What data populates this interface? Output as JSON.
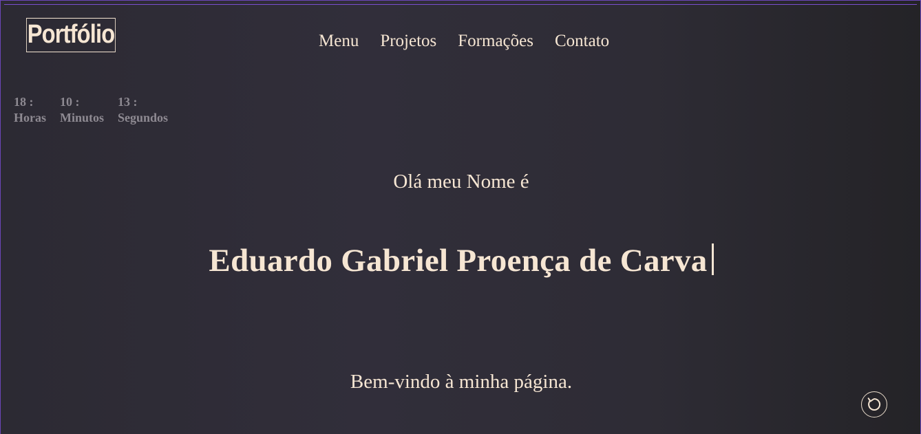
{
  "header": {
    "logo": "Portfólio",
    "nav": [
      "Menu",
      "Projetos",
      "Formações",
      "Contato"
    ]
  },
  "clock": {
    "hours_value": "18 :",
    "hours_label": "Horas",
    "minutes_value": "10 :",
    "minutes_label": "Minutos",
    "seconds_value": "13 :",
    "seconds_label": "Segundos"
  },
  "hero": {
    "greeting": "Olá meu Nome é",
    "name": "Eduardo Gabriel Proença de Carva",
    "welcome": "Bem-vindo à minha página."
  },
  "controls": {
    "refresh_icon": "refresh-icon"
  },
  "colors": {
    "text": "#f6e6d3",
    "muted": "#8e8a92",
    "border_accent": "#6b46b8"
  }
}
